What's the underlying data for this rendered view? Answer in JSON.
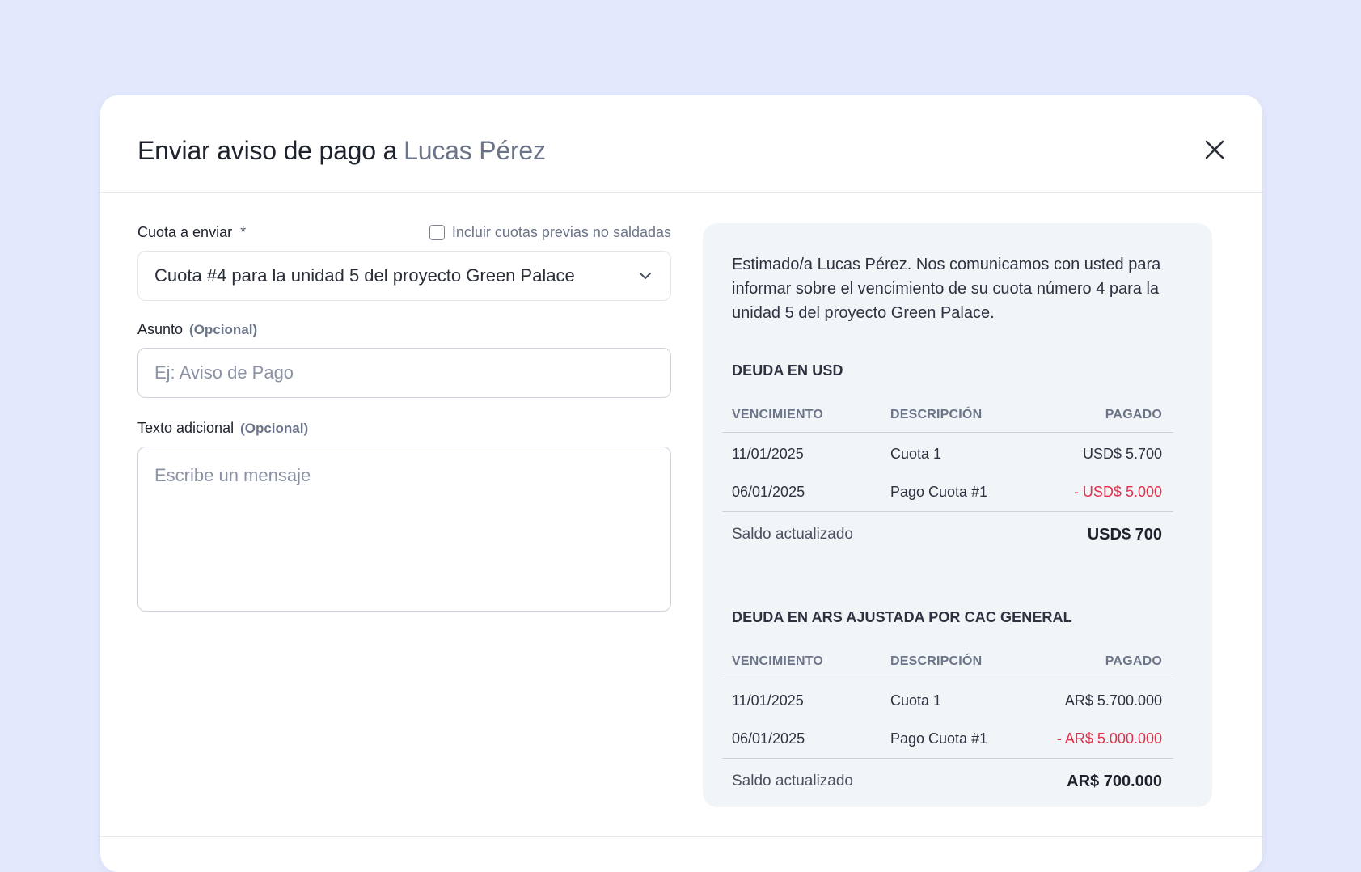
{
  "modal": {
    "title": "Enviar aviso de pago a",
    "recipient": "Lucas Pérez"
  },
  "form": {
    "cuota_label": "Cuota a enviar",
    "required_mark": "*",
    "include_previous_label": "Incluir cuotas previas no saldadas",
    "include_previous_checked": false,
    "cuota_selected": "Cuota #4 para la unidad 5 del proyecto Green Palace",
    "subject_label": "Asunto",
    "subject_optional": "(Opcional)",
    "subject_placeholder": "Ej: Aviso de Pago",
    "extra_label": "Texto adicional",
    "extra_optional": "(Opcional)",
    "extra_placeholder": "Escribe un mensaje"
  },
  "preview": {
    "intro": "Estimado/a Lucas Pérez. Nos comunicamos con usted para informar sobre el vencimiento de su cuota número 4 para la unidad 5 del proyecto Green Palace.",
    "usd": {
      "title": "DEUDA EN USD",
      "headers": [
        "VENCIMIENTO",
        "DESCRIPCIÓN",
        "PAGADO"
      ],
      "rows": [
        {
          "date": "11/01/2025",
          "desc": "Cuota 1",
          "amount": "USD$ 5.700"
        },
        {
          "date": "06/01/2025",
          "desc": "Pago Cuota #1",
          "amount": "- USD$ 5.000"
        }
      ],
      "total_label": "Saldo actualizado",
      "total_value": "USD$ 700"
    },
    "ars": {
      "title": "DEUDA EN ARS AJUSTADA POR CAC GENERAL",
      "headers": [
        "VENCIMIENTO",
        "DESCRIPCIÓN",
        "PAGADO"
      ],
      "rows": [
        {
          "date": "11/01/2025",
          "desc": "Cuota 1",
          "amount": "AR$ 5.700.000"
        },
        {
          "date": "06/01/2025",
          "desc": "Pago Cuota #1",
          "amount": "- AR$ 5.000.000"
        }
      ],
      "total_label": "Saldo actualizado",
      "total_value": "AR$ 700.000"
    }
  },
  "colors": {
    "page_bg": "#e3e8fc",
    "negative": "#e0304e",
    "panel_bg": "#f2f5f8"
  }
}
